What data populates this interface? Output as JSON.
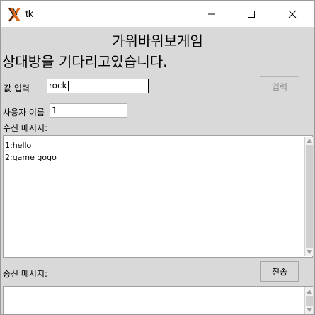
{
  "window": {
    "title": "tk",
    "icons": {
      "app": "tk-feather-icon",
      "minimize": "minimize-icon",
      "maximize": "maximize-icon",
      "close": "close-icon"
    }
  },
  "header": {
    "game_title": "가위바위보게임",
    "status": "상대방을 기다리고있습니다."
  },
  "value_input": {
    "label": "값 입력",
    "value": "rock",
    "button_label": "입력",
    "button_enabled": false
  },
  "user": {
    "label": "사용자 이름",
    "value": "1"
  },
  "received": {
    "label": "수신 메시지:",
    "lines": [
      "1:hello",
      "2:game gogo"
    ]
  },
  "send": {
    "label": "송신 메시지:",
    "button_label": "전송",
    "value": ""
  },
  "colors": {
    "content_bg": "#d9d9d9",
    "titlebar_bg": "#ffffff",
    "disabled_text": "#8c8c8c"
  }
}
